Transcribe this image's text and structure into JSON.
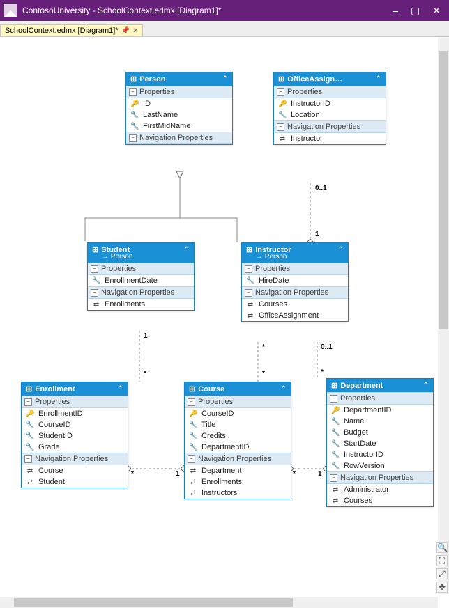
{
  "window_title": "ContosoUniversity - SchoolContext.edmx [Diagram1]*",
  "tab_label": "SchoolContext.edmx [Diagram1]*",
  "entities": {
    "person": {
      "title": "Person",
      "sections": {
        "props_label": "Properties",
        "nav_label": "Navigation Properties"
      },
      "props": [
        "ID",
        "LastName",
        "FirstMidName"
      ],
      "nav": []
    },
    "office": {
      "title": "OfficeAssign…",
      "sections": {
        "props_label": "Properties",
        "nav_label": "Navigation Properties"
      },
      "props": [
        "InstructorID",
        "Location"
      ],
      "nav": [
        "Instructor"
      ]
    },
    "student": {
      "title": "Student",
      "base": "Person",
      "sections": {
        "props_label": "Properties",
        "nav_label": "Navigation Properties"
      },
      "props": [
        "EnrollmentDate"
      ],
      "nav": [
        "Enrollments"
      ]
    },
    "instructor": {
      "title": "Instructor",
      "base": "Person",
      "sections": {
        "props_label": "Properties",
        "nav_label": "Navigation Properties"
      },
      "props": [
        "HireDate"
      ],
      "nav": [
        "Courses",
        "OfficeAssignment"
      ]
    },
    "enrollment": {
      "title": "Enrollment",
      "sections": {
        "props_label": "Properties",
        "nav_label": "Navigation Properties"
      },
      "props": [
        "EnrollmentID",
        "CourseID",
        "StudentID",
        "Grade"
      ],
      "nav": [
        "Course",
        "Student"
      ]
    },
    "course": {
      "title": "Course",
      "sections": {
        "props_label": "Properties",
        "nav_label": "Navigation Properties"
      },
      "props": [
        "CourseID",
        "Title",
        "Credits",
        "DepartmentID"
      ],
      "nav": [
        "Department",
        "Enrollments",
        "Instructors"
      ]
    },
    "department": {
      "title": "Department",
      "sections": {
        "props_label": "Properties",
        "nav_label": "Navigation Properties"
      },
      "props": [
        "DepartmentID",
        "Name",
        "Budget",
        "StartDate",
        "InstructorID",
        "RowVersion"
      ],
      "nav": [
        "Administrator",
        "Courses"
      ]
    }
  },
  "multiplicities": {
    "office_instructor_top": "0..1",
    "office_instructor_bottom": "1",
    "student_enrollment_top": "1",
    "student_enrollment_bottom": "*",
    "instructor_course_top": "*",
    "instructor_course_bottom": "*",
    "instructor_department_top": "0..1",
    "instructor_department_bottom": "*",
    "enrollment_course_left": "*",
    "enrollment_course_right": "1",
    "course_department_left": "*",
    "course_department_right": "1"
  },
  "icons": {
    "key": "🔑",
    "wrench": "🔧",
    "nav": "⇄",
    "entity": "⊞"
  }
}
